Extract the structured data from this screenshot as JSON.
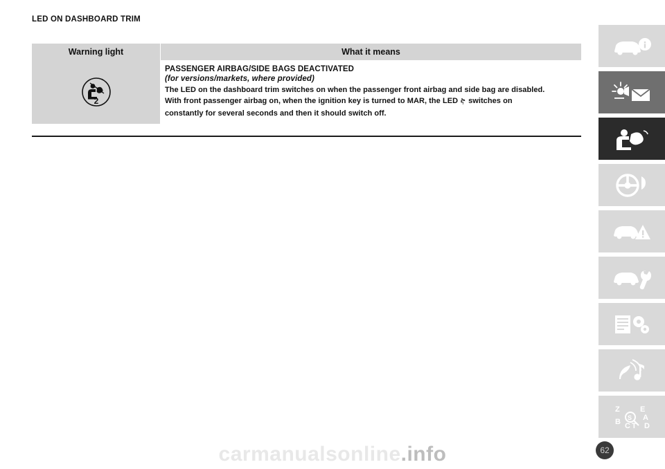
{
  "document": {
    "heading": "LED ON DASHBOARD TRIM",
    "page_number": "62",
    "watermark_main": "carmanualsonline",
    "watermark_suffix": ".info"
  },
  "table": {
    "headers": {
      "warning_light": "Warning light",
      "what_it_means": "What it means"
    },
    "row": {
      "icon_name": "passenger-airbag-deactivated-icon",
      "title": "PASSENGER AIRBAG/SIDE BAGS DEACTIVATED",
      "subtitle": "(for versions/markets, where provided)",
      "body_line1": "The LED on the dashboard trim switches on when the passenger front airbag and side bag are disabled.",
      "body_line2_a": "With front passenger airbag on, when the ignition key is turned to MAR, the LED",
      "body_line2_b": "switches on",
      "body_line3": "constantly for several seconds and then it should switch off."
    }
  },
  "side_tabs": [
    {
      "name": "tab-dashboard-and-controls",
      "icon": "car-info-icon",
      "state": "inactive"
    },
    {
      "name": "tab-lights-and-messages",
      "icon": "lights-messages-icon",
      "state": "active"
    },
    {
      "name": "tab-safety",
      "icon": "airbag-safety-icon",
      "state": "dark"
    },
    {
      "name": "tab-starting-and-driving",
      "icon": "steering-wheel-icon",
      "state": "inactive"
    },
    {
      "name": "tab-in-emergency",
      "icon": "car-warning-icon",
      "state": "inactive"
    },
    {
      "name": "tab-maintenance-and-care",
      "icon": "car-wrench-icon",
      "state": "inactive"
    },
    {
      "name": "tab-technical-specifications",
      "icon": "spec-list-gear-icon",
      "state": "inactive"
    },
    {
      "name": "tab-multimedia",
      "icon": "audio-note-icon",
      "state": "inactive"
    },
    {
      "name": "tab-index",
      "icon": "alphabetical-index-icon",
      "state": "inactive"
    }
  ]
}
